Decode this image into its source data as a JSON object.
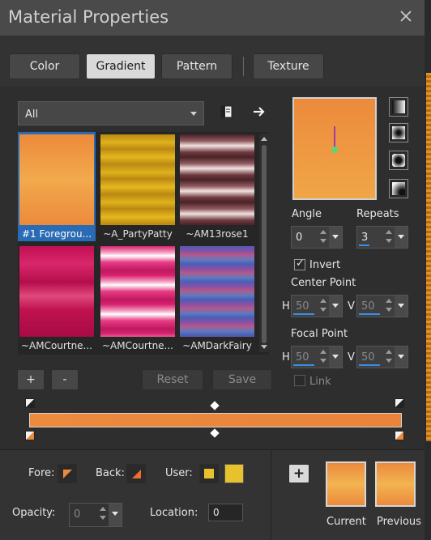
{
  "window": {
    "title": "Material Properties"
  },
  "tabs": [
    {
      "label": "Color",
      "active": false
    },
    {
      "label": "Gradient",
      "active": true
    },
    {
      "label": "Pattern",
      "active": false
    },
    {
      "label": "Texture",
      "active": false
    }
  ],
  "category": {
    "selected": "All"
  },
  "gradients": [
    {
      "caption": "#1 Foregrou...",
      "selected": true
    },
    {
      "caption": "~A_PartyPatty",
      "selected": false
    },
    {
      "caption": "~AM13rose1",
      "selected": false
    },
    {
      "caption": "~AMCourtne...",
      "selected": false
    },
    {
      "caption": "~AMCourtne...",
      "selected": false
    },
    {
      "caption": "~AMDarkFairy",
      "selected": false
    }
  ],
  "list_buttons": {
    "add": "+",
    "remove": "-",
    "reset": "Reset",
    "save": "Save"
  },
  "angle": {
    "label": "Angle",
    "value": "0"
  },
  "repeats": {
    "label": "Repeats",
    "value": "3",
    "fraction": 0.3
  },
  "invert": {
    "label": "Invert",
    "checked": true
  },
  "center_point": {
    "label": "Center Point",
    "h_label": "H",
    "h_value": "50",
    "v_label": "V",
    "v_value": "50"
  },
  "focal_point": {
    "label": "Focal Point",
    "h_label": "H",
    "h_value": "50",
    "v_label": "V",
    "v_value": "50"
  },
  "link": {
    "label": "Link",
    "checked": false
  },
  "bottom": {
    "fore_label": "Fore:",
    "back_label": "Back:",
    "user_label": "User:",
    "opacity_label": "Opacity:",
    "opacity_value": "0",
    "location_label": "Location:",
    "location_value": "0",
    "current_label": "Current",
    "previous_label": "Previous",
    "add_label": "+"
  },
  "colors": {
    "accent": "#2a6bb5",
    "gradient_start": "#ec8a3c",
    "gradient_mid": "#f2b451",
    "user_color": "#e8c22c"
  }
}
